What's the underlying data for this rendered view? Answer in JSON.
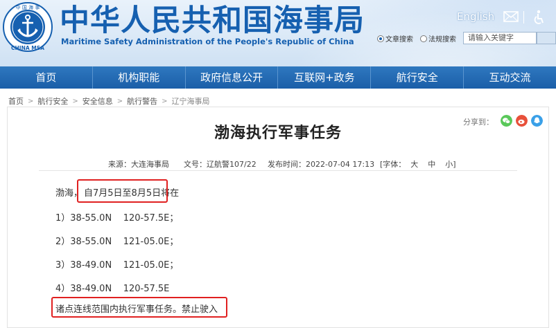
{
  "header": {
    "logo_text": "中国海事 CHINA MSA",
    "title_cn": "中华人民共和国海事局",
    "title_en": "Maritime Safety Administration of the People's Republic of China",
    "english_link": "English",
    "search": {
      "option_doc": "文章搜索",
      "option_law": "法规搜索",
      "placeholder": "请输入关键字"
    }
  },
  "nav": {
    "items": [
      "首页",
      "机构职能",
      "政府信息公开",
      "互联网+政务",
      "航行安全",
      "互动交流"
    ]
  },
  "breadcrumb": [
    "首页",
    "航行安全",
    "安全信息",
    "航行警告",
    "辽宁海事局"
  ],
  "share_label": "分享到：",
  "article": {
    "title": "渤海执行军事任务",
    "source": "来源：大连海事局",
    "doc_no": "文号：辽航警107/22",
    "publish_time": "发布时间：2022-07-04 17:13",
    "font_label": "[字体：",
    "font_large": "大",
    "font_medium": "中",
    "font_small": "小",
    "font_close": "]",
    "intro_prefix": "渤海，",
    "intro_highlight": "自7月5日至8月5日",
    "intro_suffix": "将在",
    "points": [
      "1）38-55.0N    120-57.5E；",
      "2）38-55.0N    121-05.0E；",
      "3）38-49.0N    121-05.0E；",
      "4）38-49.0N    120-57.5E"
    ],
    "closing": "诸点连线范围内执行军事任务。禁止驶入"
  },
  "colors": {
    "brand_blue": "#1660b0",
    "nav_blue": "#1a5ea8",
    "highlight_red": "#e02020",
    "wechat_green": "#5ac85a",
    "weibo_red": "#e8503a",
    "qq_blue": "#3aa0e8"
  }
}
